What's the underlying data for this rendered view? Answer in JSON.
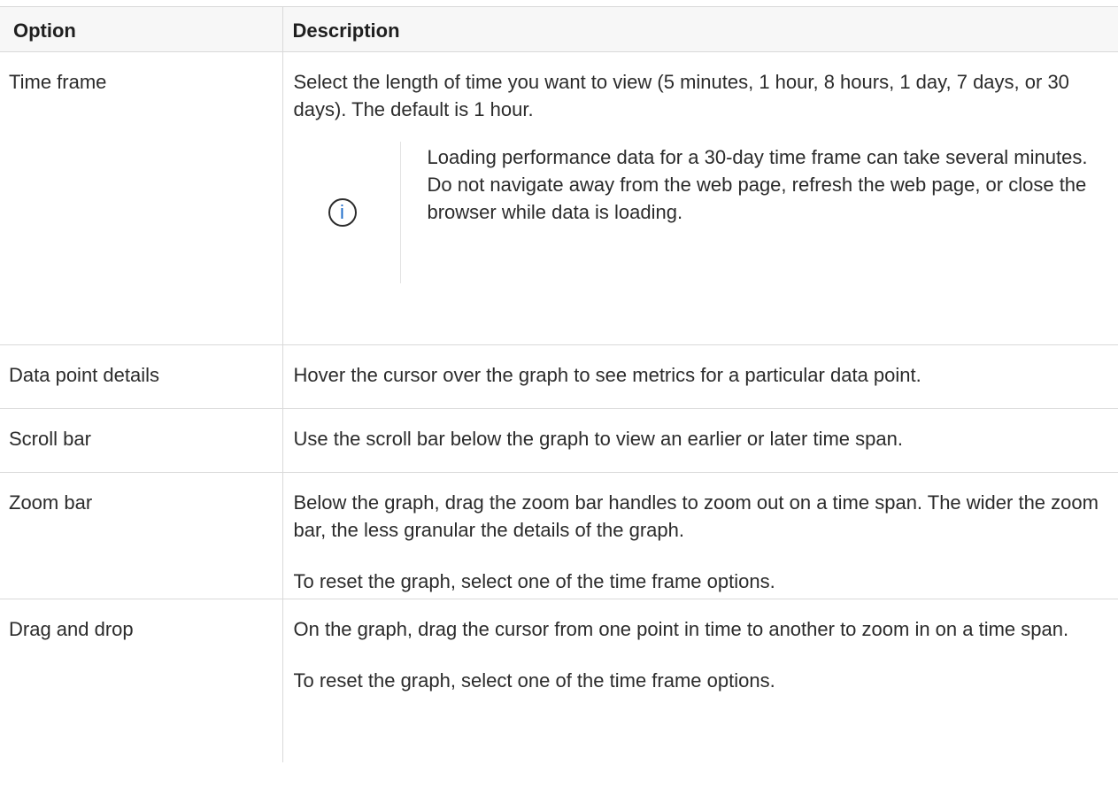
{
  "table": {
    "headers": {
      "option": "Option",
      "description": "Description"
    },
    "rows": [
      {
        "option": "Time frame",
        "description": "Select the length of time you want to view (5 minutes, 1 hour, 8 hours, 1 day, 7 days, or 30 days). The default is 1 hour.",
        "note": {
          "icon": "info-icon",
          "icon_glyph": "i",
          "text": "Loading performance data for a 30-day time frame can take several minutes. Do not navigate away from the web page, refresh the web page, or close the browser while data is loading."
        }
      },
      {
        "option": "Data point details",
        "description": "Hover the cursor over the graph to see metrics for a particular data point."
      },
      {
        "option": "Scroll bar",
        "description": "Use the scroll bar below the graph to view an earlier or later time span."
      },
      {
        "option": "Zoom bar",
        "description": "Below the graph, drag the zoom bar handles to zoom out on a time span. The wider the zoom bar, the less granular the details of the graph.",
        "description_2": "To reset the graph, select one of the time frame options."
      },
      {
        "option": "Drag and drop",
        "description": "On the graph, drag the cursor from one point in time to another to zoom in on a time span.",
        "description_2": "To reset the graph, select one of the time frame options."
      }
    ]
  },
  "colors": {
    "icon_ring": "#2c2c2c",
    "icon_glyph": "#1b6ac9",
    "header_bg": "#f7f7f7",
    "border": "#d9d9d9"
  }
}
